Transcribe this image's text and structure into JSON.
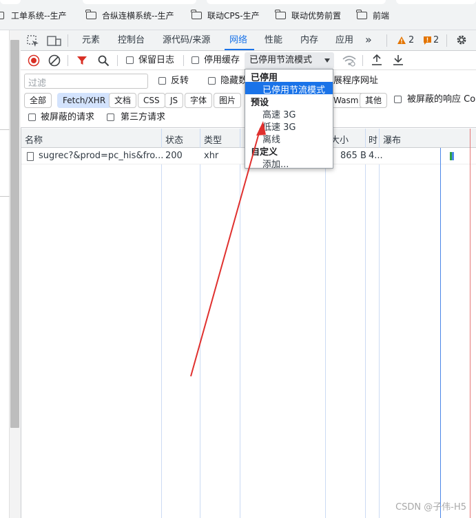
{
  "bookmarks": [
    {
      "label": "工单系统--生产"
    },
    {
      "label": "合纵连横系统--生产"
    },
    {
      "label": "联动CPS-生产"
    },
    {
      "label": "联动优势前置"
    },
    {
      "label": "前端"
    }
  ],
  "devtools": {
    "tabs": [
      "元素",
      "控制台",
      "源代码/来源",
      "网络",
      "性能",
      "内存",
      "应用"
    ],
    "active_tab": "网络",
    "more_tabs": "»",
    "warnings_count": "2",
    "issues_count": "2"
  },
  "toolbar": {
    "preserve_log": "保留日志",
    "disable_cache": "停用缓存",
    "throttle_value": "已停用节流模式"
  },
  "filter_bar": {
    "placeholder": "过滤",
    "invert": "反转",
    "hide_data_urls": "隐藏数",
    "extension_urls": "展程序网址",
    "blocked_responses": "被屏蔽的响应 Co"
  },
  "type_filters": [
    "全部",
    "Fetch/XHR",
    "文档",
    "CSS",
    "JS",
    "字体",
    "图片",
    "Wasm",
    "其他"
  ],
  "active_type_filter": "Fetch/XHR",
  "request_filters": {
    "blocked_requests": "被屏蔽的请求",
    "third_party": "第三方请求"
  },
  "table": {
    "columns": [
      "名称",
      "状态",
      "类型",
      "大小",
      "时",
      "瀑布"
    ],
    "rows": [
      {
        "name": "sugrec?&prod=pc_his&fro...",
        "status": "200",
        "type": "xhr",
        "size": "865 B",
        "time": "4..."
      }
    ]
  },
  "throttle_dropdown": {
    "group_disabled": "已停用",
    "item_disabled": "已停用节流模式",
    "group_presets": "预设",
    "item_fast3g": "高速 3G",
    "item_slow3g": "低速 3G",
    "item_offline": "离线",
    "group_custom": "自定义",
    "item_add": "添加..."
  },
  "watermark": "CSDN @子伟-H5",
  "colors": {
    "accent": "#1a73e8",
    "record_red": "#d93025",
    "filter_red": "#d93025",
    "warning": "#e37400",
    "arrow": "#e0302e"
  }
}
